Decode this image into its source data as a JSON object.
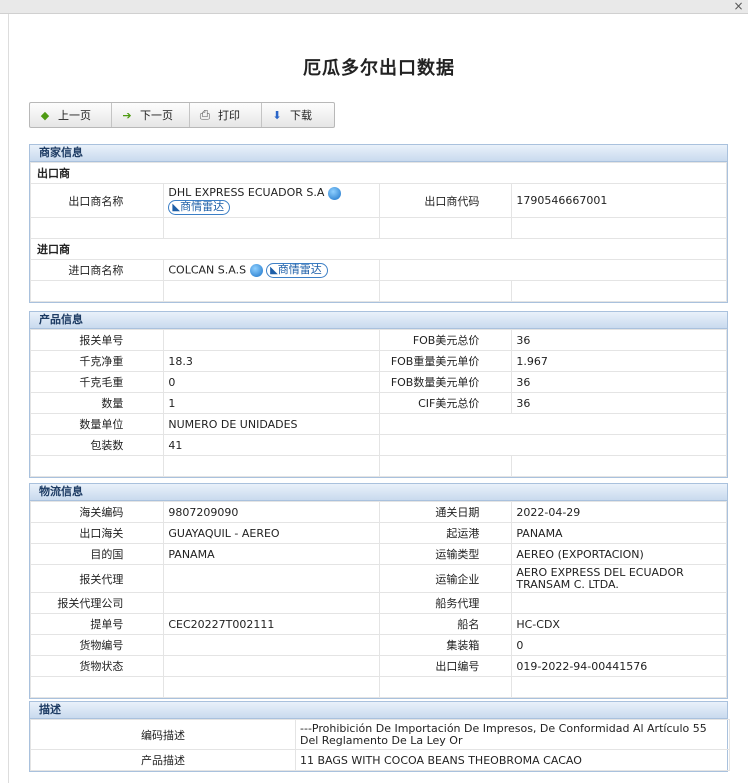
{
  "window": {
    "close_glyph": "×"
  },
  "title": "厄瓜多尔出口数据",
  "toolbar": {
    "prev": "上一页",
    "next": "下一页",
    "print": "打印",
    "download": "下载"
  },
  "merchant": {
    "header": "商家信息",
    "exporter_group": "出口商",
    "exporter_name_label": "出口商名称",
    "exporter_name": "DHL EXPRESS ECUADOR S.A",
    "exporter_code_label": "出口商代码",
    "exporter_code": "1790546667001",
    "radar_label": "商情雷达",
    "importer_group": "进口商",
    "importer_name_label": "进口商名称",
    "importer_name": "COLCAN S.A.S"
  },
  "product": {
    "header": "产品信息",
    "rows": [
      {
        "l1": "报关单号",
        "v1": "",
        "l2": "FOB美元总价",
        "v2": "36"
      },
      {
        "l1": "千克净重",
        "v1": "18.3",
        "l2": "FOB重量美元单价",
        "v2": "1.967"
      },
      {
        "l1": "千克毛重",
        "v1": "0",
        "l2": "FOB数量美元单价",
        "v2": "36"
      },
      {
        "l1": "数量",
        "v1": "1",
        "l2": "CIF美元总价",
        "v2": "36"
      },
      {
        "l1": "数量单位",
        "v1": "NUMERO DE UNIDADES"
      },
      {
        "l1": "包装数",
        "v1": "41"
      }
    ]
  },
  "logistics": {
    "header": "物流信息",
    "rows": [
      {
        "l1": "海关编码",
        "v1": "9807209090",
        "l2": "通关日期",
        "v2": "2022-04-29"
      },
      {
        "l1": "出口海关",
        "v1": "GUAYAQUIL - AEREO",
        "l2": "起运港",
        "v2": "PANAMA"
      },
      {
        "l1": "目的国",
        "v1": "PANAMA",
        "l2": "运输类型",
        "v2": "AEREO (EXPORTACION)"
      },
      {
        "l1": "报关代理",
        "v1": "",
        "l2": "运输企业",
        "v2": "AERO EXPRESS DEL ECUADOR TRANSAM C. LTDA."
      },
      {
        "l1": "报关代理公司",
        "v1": "",
        "l2": "船务代理",
        "v2": ""
      },
      {
        "l1": "提单号",
        "v1": "CEC20227T002111",
        "l2": "船名",
        "v2": "HC-CDX"
      },
      {
        "l1": "货物编号",
        "v1": "",
        "l2": "集装箱",
        "v2": "0"
      },
      {
        "l1": "货物状态",
        "v1": "",
        "l2": "出口编号",
        "v2": "019-2022-94-00441576"
      }
    ]
  },
  "description": {
    "header": "描述",
    "code_desc_label": "编码描述",
    "code_desc": "---Prohibición De Importación De Impresos, De Conformidad Al Artículo 55 Del Reglamento De La Ley Or",
    "product_desc_label": "产品描述",
    "product_desc": "11 BAGS WITH COCOA BEANS THEOBROMA CACAO"
  }
}
